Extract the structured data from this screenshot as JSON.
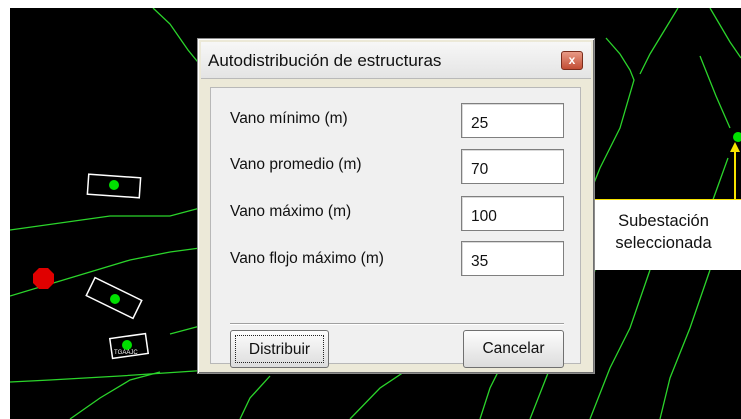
{
  "dialog": {
    "title": "Autodistribución de estructuras",
    "close_label": "x",
    "fields": [
      {
        "label": "Vano mínimo (m)",
        "value": "25"
      },
      {
        "label": "Vano promedio (m)",
        "value": "70"
      },
      {
        "label": "Vano máximo (m)",
        "value": "100"
      },
      {
        "label": "Vano flojo máximo (m)",
        "value": "35"
      }
    ],
    "buttons": {
      "distribute_label": "Distribuir",
      "cancel_label": "Cancelar"
    }
  },
  "annotation": {
    "line1": "Subestación",
    "line2": "seleccionada"
  },
  "map": {
    "tiny_label": "TGAAJC",
    "colors": {
      "background": "#000000",
      "contour": "#2bd42b",
      "structure_outline": "#ffffff",
      "structure_marker": "#00e000",
      "substation_marker": "#e00000",
      "callout_accent": "#f7e300"
    }
  }
}
